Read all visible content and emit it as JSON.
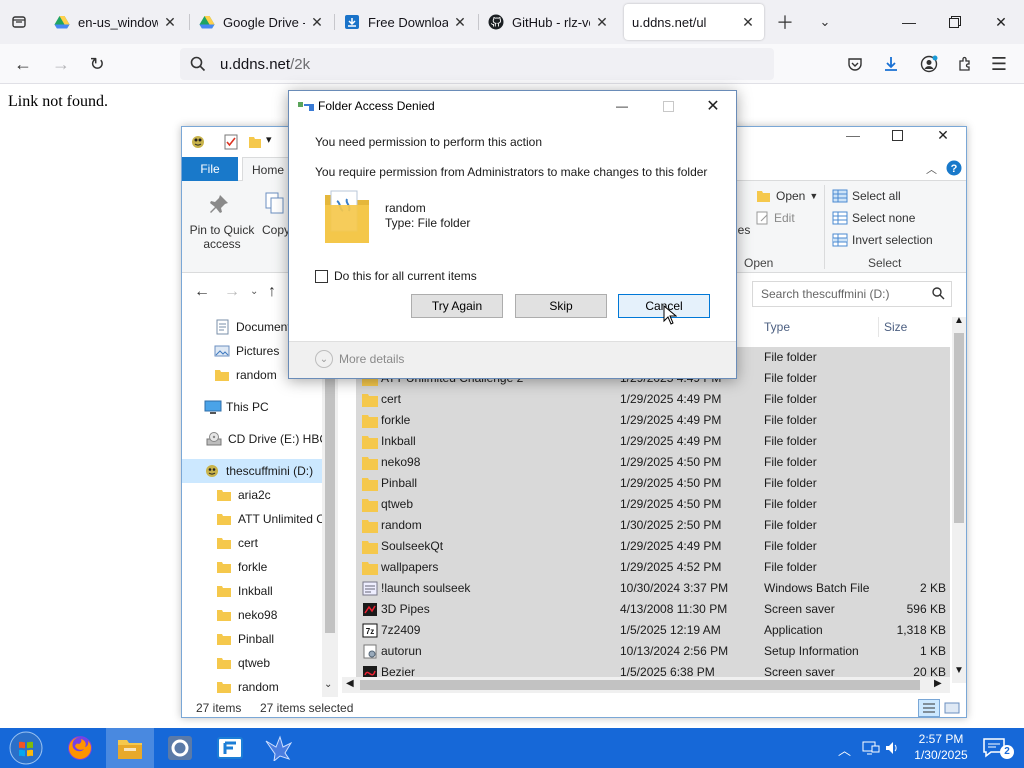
{
  "browser": {
    "tabs": [
      {
        "title": "en-us_windows",
        "icon": "google-drive-icon"
      },
      {
        "title": "Google Drive - V",
        "icon": "google-drive-icon"
      },
      {
        "title": "Free Download I",
        "icon": "download-site-icon"
      },
      {
        "title": "GitHub - rlz-ve/x",
        "icon": "github-icon"
      },
      {
        "title": "u.ddns.net/ul",
        "icon": "none"
      }
    ],
    "url_host": "u.ddns.net",
    "url_path": "/2k",
    "page_text": "Link not found."
  },
  "explorer": {
    "ribbon_tabs": {
      "file": "File",
      "home": "Home"
    },
    "ribbon": {
      "pin_label": "Pin to Quick access",
      "copy_label": "Copy",
      "properties_fragment": "ies",
      "open_label": "Open",
      "edit_label": "Edit",
      "open_group": "Open",
      "select_all": "Select all",
      "select_none": "Select none",
      "invert_selection": "Invert selection",
      "select_group": "Select"
    },
    "search_placeholder": "Search thescuffmini (D:)",
    "nav_items": [
      {
        "label": "Document",
        "icon": "documents-icon"
      },
      {
        "label": "Pictures",
        "icon": "pictures-icon"
      },
      {
        "label": "random",
        "icon": "folder-icon"
      },
      {
        "label": "This PC",
        "icon": "computer-icon"
      },
      {
        "label": "CD Drive (E:) HBC",
        "icon": "cd-drive-icon"
      },
      {
        "label": "thescuffmini (D:)",
        "icon": "drive-icon"
      },
      {
        "label": "aria2c",
        "icon": "folder-icon"
      },
      {
        "label": "ATT Unlimited C",
        "icon": "folder-icon"
      },
      {
        "label": "cert",
        "icon": "folder-icon"
      },
      {
        "label": "forkle",
        "icon": "folder-icon"
      },
      {
        "label": "Inkball",
        "icon": "folder-icon"
      },
      {
        "label": "neko98",
        "icon": "folder-icon"
      },
      {
        "label": "Pinball",
        "icon": "folder-icon"
      },
      {
        "label": "qtweb",
        "icon": "folder-icon"
      },
      {
        "label": "random",
        "icon": "folder-icon"
      }
    ],
    "columns": {
      "type": "Type",
      "size": "Size"
    },
    "rows": [
      {
        "name": "",
        "date": "",
        "type": "File folder",
        "size": "",
        "icon": "folder-icon"
      },
      {
        "name": "ATT Unlimited Challenge 2",
        "date": "1/29/2025 4:49 PM",
        "type": "File folder",
        "size": "",
        "icon": "folder-icon"
      },
      {
        "name": "cert",
        "date": "1/29/2025 4:49 PM",
        "type": "File folder",
        "size": "",
        "icon": "folder-icon"
      },
      {
        "name": "forkle",
        "date": "1/29/2025 4:49 PM",
        "type": "File folder",
        "size": "",
        "icon": "folder-icon"
      },
      {
        "name": "Inkball",
        "date": "1/29/2025 4:49 PM",
        "type": "File folder",
        "size": "",
        "icon": "folder-icon"
      },
      {
        "name": "neko98",
        "date": "1/29/2025 4:50 PM",
        "type": "File folder",
        "size": "",
        "icon": "folder-icon"
      },
      {
        "name": "Pinball",
        "date": "1/29/2025 4:50 PM",
        "type": "File folder",
        "size": "",
        "icon": "folder-icon"
      },
      {
        "name": "qtweb",
        "date": "1/29/2025 4:50 PM",
        "type": "File folder",
        "size": "",
        "icon": "folder-icon"
      },
      {
        "name": "random",
        "date": "1/30/2025 2:50 PM",
        "type": "File folder",
        "size": "",
        "icon": "folder-icon"
      },
      {
        "name": "SoulseekQt",
        "date": "1/29/2025 4:49 PM",
        "type": "File folder",
        "size": "",
        "icon": "folder-icon"
      },
      {
        "name": "wallpapers",
        "date": "1/29/2025 4:52 PM",
        "type": "File folder",
        "size": "",
        "icon": "folder-icon"
      },
      {
        "name": "!launch soulseek",
        "date": "10/30/2024 3:37 PM",
        "type": "Windows Batch File",
        "size": "2 KB",
        "icon": "batch-file-icon"
      },
      {
        "name": "3D Pipes",
        "date": "4/13/2008 11:30 PM",
        "type": "Screen saver",
        "size": "596 KB",
        "icon": "screensaver-icon"
      },
      {
        "name": "7z2409",
        "date": "1/5/2025 12:19 AM",
        "type": "Application",
        "size": "1,318 KB",
        "icon": "7zip-icon"
      },
      {
        "name": "autorun",
        "date": "10/13/2024 2:56 PM",
        "type": "Setup Information",
        "size": "1 KB",
        "icon": "setup-info-icon"
      },
      {
        "name": "Bezier",
        "date": "1/5/2025 6:38 PM",
        "type": "Screen saver",
        "size": "20 KB",
        "icon": "screensaver-icon"
      }
    ],
    "status_count": "27 items",
    "status_selected": "27 items selected"
  },
  "dialog": {
    "title": "Folder Access Denied",
    "heading": "You need permission to perform this action",
    "message": "You require permission from Administrators to make changes to this folder",
    "item_name": "random",
    "item_type": "Type: File folder",
    "checkbox_label": "Do this for all current items",
    "checkbox_checked": false,
    "buttons": {
      "try_again": "Try Again",
      "skip": "Skip",
      "cancel": "Cancel"
    },
    "more_details": "More details"
  },
  "taskbar": {
    "items": [
      "start-orb-icon",
      "firefox-icon",
      "file-explorer-icon",
      "obs-like-icon",
      "app-f-icon",
      "bird-app-icon"
    ],
    "time": "2:57 PM",
    "date": "1/30/2025",
    "notification_count": "2"
  },
  "colors": {
    "accent": "#1979ca",
    "taskbar": "#1668d8",
    "selection": "#d9d9d9",
    "nav_selected": "#cce8ff",
    "folder": "#f5c84c"
  }
}
